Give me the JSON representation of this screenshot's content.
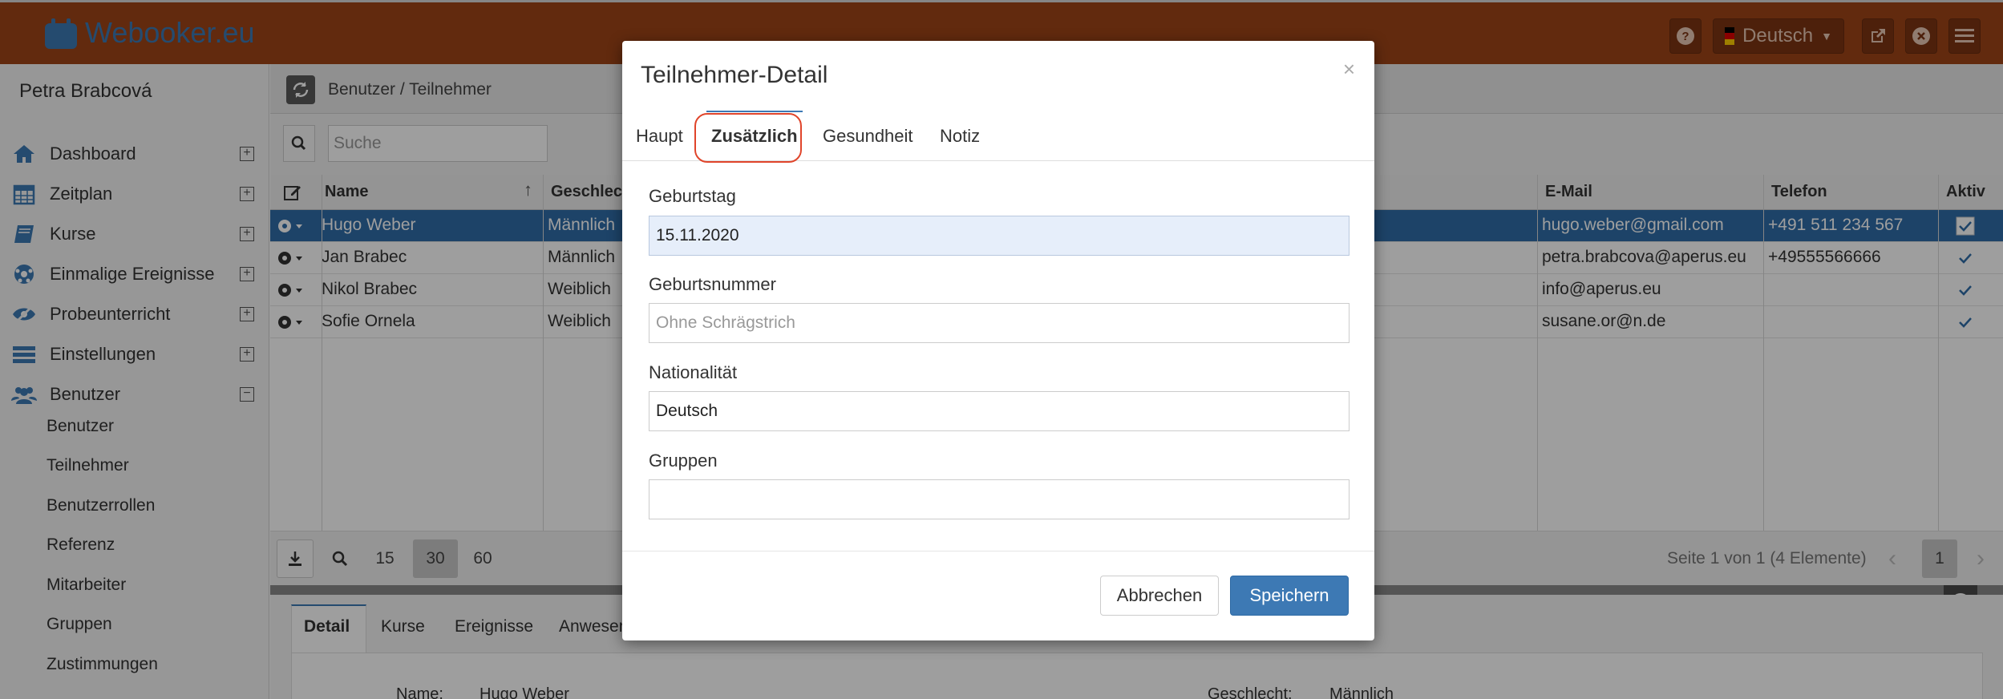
{
  "app": {
    "brand": "Webooker.eu",
    "language": "Deutsch"
  },
  "sidebar": {
    "user": "Petra Brabcová",
    "items": [
      {
        "label": "Dashboard",
        "icon": "home-icon",
        "toggle": "+"
      },
      {
        "label": "Zeitplan",
        "icon": "calendar-icon",
        "toggle": "+"
      },
      {
        "label": "Kurse",
        "icon": "book-icon",
        "toggle": "+"
      },
      {
        "label": "Einmalige Ereignisse",
        "icon": "soccer-ball-icon",
        "toggle": "+"
      },
      {
        "label": "Probeunterricht",
        "icon": "eye-slash-icon",
        "toggle": "+"
      },
      {
        "label": "Einstellungen",
        "icon": "tasks-icon",
        "toggle": "+"
      },
      {
        "label": "Benutzer",
        "icon": "users-icon",
        "toggle": "−"
      }
    ],
    "sub_items": [
      "Benutzer",
      "Teilnehmer",
      "Benutzerrollen",
      "Referenz",
      "Mitarbeiter",
      "Gruppen",
      "Zustimmungen"
    ]
  },
  "main": {
    "breadcrumb": "Benutzer / Teilnehmer",
    "search_placeholder": "Suche",
    "columns": {
      "name": "Name",
      "gender": "Geschlech",
      "email": "E-Mail",
      "phone": "Telefon",
      "active": "Aktiv"
    },
    "rows": [
      {
        "name": "Hugo Weber",
        "gender": "Männlich",
        "email": "hugo.weber@gmail.com",
        "phone": "+491 511 234 567",
        "active": true
      },
      {
        "name": "Jan Brabec",
        "gender": "Männlich",
        "email": "petra.brabcova@aperus.eu",
        "phone": "+49555566666",
        "active": true
      },
      {
        "name": "Nikol Brabec",
        "gender": "Weiblich",
        "email": "info@aperus.eu",
        "phone": "",
        "active": true
      },
      {
        "name": "Sofie Ornela",
        "gender": "Weiblich",
        "email": "susane.or@n.de",
        "phone": "",
        "active": true
      }
    ],
    "page_sizes": [
      "15",
      "30",
      "60"
    ],
    "active_page_size": "30",
    "pager_info": "Seite 1 von 1 (4 Elemente)",
    "current_page": "1"
  },
  "detail": {
    "tabs": [
      "Detail",
      "Kurse",
      "Ereignisse",
      "Anwesen"
    ],
    "name_label": "Name:",
    "name_value": "Hugo Weber",
    "gender_label": "Geschlecht:",
    "gender_value": "Männlich"
  },
  "modal": {
    "title": "Teilnehmer-Detail",
    "close": "×",
    "tabs": [
      "Haupt",
      "Zusätzlich",
      "Gesundheit",
      "Notiz"
    ],
    "active_tab": "Zusätzlich",
    "fields": {
      "birthday_label": "Geburtstag",
      "birthday_value": "15.11.2020",
      "birthnumber_label": "Geburtsnummer",
      "birthnumber_placeholder": "Ohne Schrägstrich",
      "nationality_label": "Nationalität",
      "nationality_value": "Deutsch",
      "groups_label": "Gruppen",
      "groups_value": ""
    },
    "cancel_label": "Abbrechen",
    "save_label": "Speichern"
  },
  "colors": {
    "topbar": "#9e4418",
    "accent": "#3d79b4",
    "selected_row": "#2f6da8",
    "highlight": "#e0452b"
  }
}
